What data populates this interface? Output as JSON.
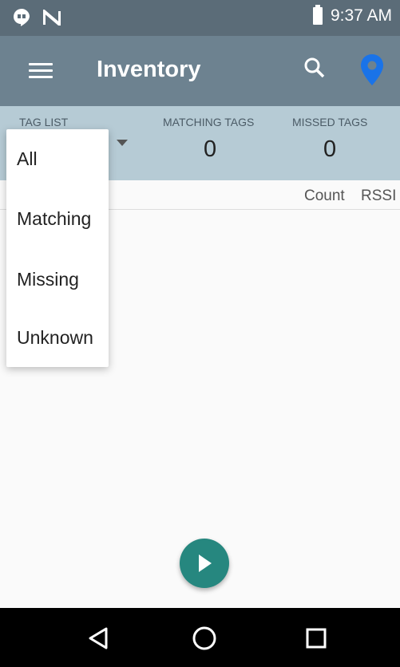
{
  "status_bar": {
    "icons": [
      "hangouts-icon",
      "n-icon",
      "battery-icon"
    ],
    "time": "9:37 AM"
  },
  "app_bar": {
    "title": "Inventory",
    "icons": [
      "menu-icon",
      "search-icon",
      "location-pin-icon"
    ]
  },
  "counters": {
    "tag_list_label": "TAG LIST",
    "matching_label": "MATCHING TAGS",
    "matching_value": "0",
    "missed_label": "MISSED TAGS",
    "missed_value": "0"
  },
  "columns": {
    "count": "Count",
    "rssi": "RSSI"
  },
  "dropdown": {
    "options": [
      "All",
      "Matching",
      "Missing",
      "Unknown"
    ]
  },
  "fab": {
    "icon": "play-icon"
  },
  "nav_bar": {
    "icons": [
      "back-icon",
      "home-icon",
      "recents-icon"
    ]
  },
  "colors": {
    "status_bar": "#5b6c78",
    "app_bar": "#6d8290",
    "counters_bg": "#b6cbd5",
    "fab": "#26877f",
    "pin": "#1a73e8"
  }
}
